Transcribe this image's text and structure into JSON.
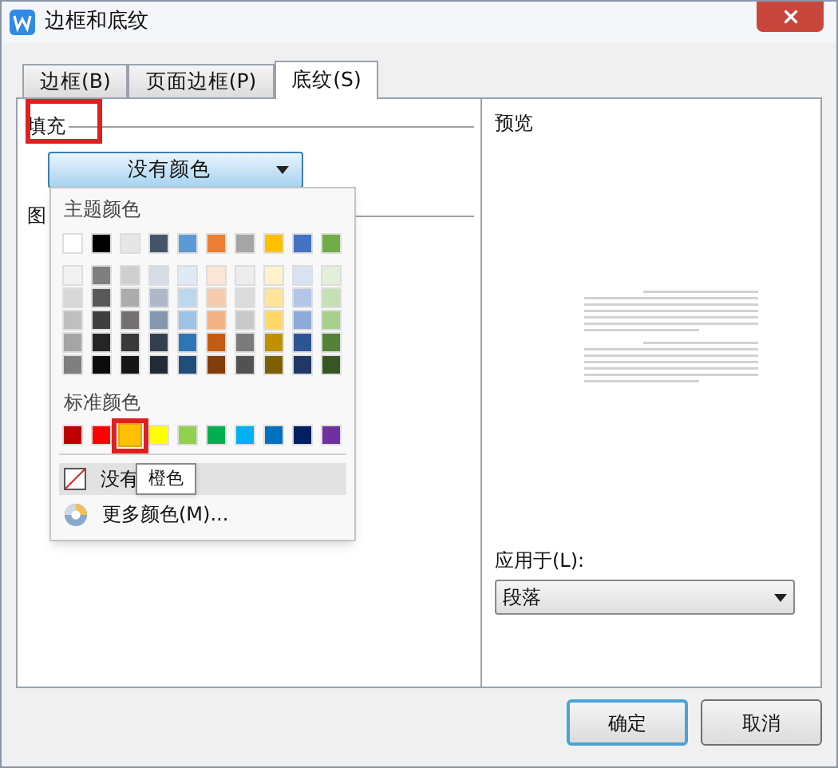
{
  "window": {
    "title": "边框和底纹"
  },
  "tabs": [
    {
      "label": "边框(B)",
      "selected": false
    },
    {
      "label": "页面边框(P)",
      "selected": false
    },
    {
      "label": "底纹(S)",
      "selected": true
    }
  ],
  "fill": {
    "label": "填充",
    "value": "没有颜色"
  },
  "pattern": {
    "label": "图"
  },
  "color_menu": {
    "theme_heading": "主题颜色",
    "theme_top": [
      {
        "color": "#ffffff"
      },
      {
        "color": "#000000"
      },
      {
        "color": "#e7e6e6"
      },
      {
        "color": "#44546a"
      },
      {
        "color": "#5b9bd5"
      },
      {
        "color": "#ed7d31"
      },
      {
        "color": "#a5a5a5"
      },
      {
        "color": "#ffc000"
      },
      {
        "color": "#4472c4"
      },
      {
        "color": "#70ad47"
      }
    ],
    "theme_shades": [
      [
        {
          "color": "#f2f2f2"
        },
        {
          "color": "#7f7f7f"
        },
        {
          "color": "#d0cece"
        },
        {
          "color": "#d6dce4"
        },
        {
          "color": "#deebf6"
        },
        {
          "color": "#fbe5d5"
        },
        {
          "color": "#ededed"
        },
        {
          "color": "#fff2cc"
        },
        {
          "color": "#d9e2f3"
        },
        {
          "color": "#e2efd9"
        }
      ],
      [
        {
          "color": "#d8d8d8"
        },
        {
          "color": "#595959"
        },
        {
          "color": "#aeabab"
        },
        {
          "color": "#adb9ca"
        },
        {
          "color": "#bdd7ee"
        },
        {
          "color": "#f7cbac"
        },
        {
          "color": "#dbdbdb"
        },
        {
          "color": "#fee599"
        },
        {
          "color": "#b4c6e7"
        },
        {
          "color": "#c5e0b3"
        }
      ],
      [
        {
          "color": "#bfbfbf"
        },
        {
          "color": "#3f3f3f"
        },
        {
          "color": "#757070"
        },
        {
          "color": "#8496b0"
        },
        {
          "color": "#9dc3e6"
        },
        {
          "color": "#f4b183"
        },
        {
          "color": "#c9c9c9"
        },
        {
          "color": "#ffd965"
        },
        {
          "color": "#8eaadb"
        },
        {
          "color": "#a8d08d"
        }
      ],
      [
        {
          "color": "#a5a5a5"
        },
        {
          "color": "#262626"
        },
        {
          "color": "#3a3838"
        },
        {
          "color": "#323f4f"
        },
        {
          "color": "#2e75b5"
        },
        {
          "color": "#c55a11"
        },
        {
          "color": "#7b7b7b"
        },
        {
          "color": "#bf9000"
        },
        {
          "color": "#2f5496"
        },
        {
          "color": "#538135"
        }
      ],
      [
        {
          "color": "#7f7f7f"
        },
        {
          "color": "#0c0c0c"
        },
        {
          "color": "#171616"
        },
        {
          "color": "#222a35"
        },
        {
          "color": "#1e4e79"
        },
        {
          "color": "#833c0b"
        },
        {
          "color": "#525252"
        },
        {
          "color": "#7f6000"
        },
        {
          "color": "#1f3864"
        },
        {
          "color": "#375623"
        }
      ]
    ],
    "standard_heading": "标准颜色",
    "standard": [
      {
        "color": "#c00000",
        "selected": false
      },
      {
        "color": "#ff0000",
        "selected": false
      },
      {
        "color": "#ffc000",
        "selected": true
      },
      {
        "color": "#ffff00",
        "selected": false
      },
      {
        "color": "#92d050",
        "selected": false
      },
      {
        "color": "#00b050",
        "selected": false
      },
      {
        "color": "#00b0f0",
        "selected": false
      },
      {
        "color": "#0070c0",
        "selected": false
      },
      {
        "color": "#002060",
        "selected": false
      },
      {
        "color": "#7030a0",
        "selected": false
      }
    ],
    "items": [
      {
        "kind": "none",
        "label": "没有",
        "highlighted": true
      },
      {
        "kind": "more",
        "label": "更多颜色(M)...",
        "highlighted": false
      }
    ],
    "tooltip": "橙色"
  },
  "preview": {
    "label": "预览"
  },
  "apply_to": {
    "label": "应用于(L):",
    "value": "段落"
  },
  "buttons": [
    {
      "label": "确定",
      "default": true
    },
    {
      "label": "取消",
      "default": false
    }
  ]
}
